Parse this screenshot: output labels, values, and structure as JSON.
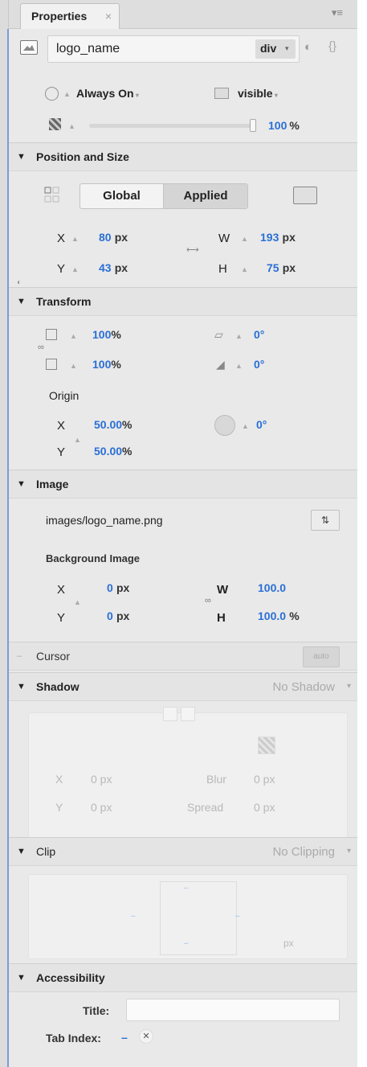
{
  "panel": {
    "tab_label": "Properties",
    "tab_close": "×",
    "menu_icon": "▾≡"
  },
  "element": {
    "name": "logo_name",
    "tag": "div",
    "tag_arrow": "▾"
  },
  "display": {
    "overflow": "Always On",
    "visibility": "visible",
    "opacity": "100",
    "opacity_unit": "%"
  },
  "position_size": {
    "title": "Position and Size",
    "mode_global": "Global",
    "mode_applied": "Applied",
    "x_label": "X",
    "x_value": "80",
    "x_unit": "px",
    "y_label": "Y",
    "y_value": "43",
    "y_unit": "px",
    "w_label": "W",
    "w_value": "193",
    "w_unit": "px",
    "h_label": "H",
    "h_value": "75",
    "h_unit": "px"
  },
  "transform": {
    "title": "Transform",
    "scale_x": "100",
    "scale_y": "100",
    "scale_unit": "%",
    "skew_x": "0°",
    "skew_y": "0°",
    "origin_label": "Origin",
    "origin_x_label": "X",
    "origin_x": "50.00",
    "origin_y_label": "Y",
    "origin_y": "50.00",
    "origin_unit": "%",
    "rotation": "0°"
  },
  "image": {
    "title": "Image",
    "path": "images/logo_name.png",
    "bg_label": "Background Image",
    "x_label": "X",
    "x_value": "0",
    "x_unit": "px",
    "y_label": "Y",
    "y_value": "0",
    "y_unit": "px",
    "w_label": "W",
    "w_value": "100.0",
    "h_label": "H",
    "h_value": "100.0",
    "size_unit": "%"
  },
  "cursor": {
    "title": "Cursor",
    "value": "auto"
  },
  "shadow": {
    "title": "Shadow",
    "value": "No Shadow",
    "x_label": "X",
    "x_value": "0 px",
    "y_label": "Y",
    "y_value": "0 px",
    "blur_label": "Blur",
    "blur_value": "0 px",
    "spread_label": "Spread",
    "spread_value": "0 px"
  },
  "clip": {
    "title": "Clip",
    "value": "No Clipping",
    "unit": "px"
  },
  "accessibility": {
    "title": "Accessibility",
    "title_label": "Title:",
    "title_value": "",
    "tabindex_label": "Tab Index:",
    "tabindex_value": "–"
  },
  "colors": {
    "accent_blue": "#2a6fd6",
    "panel_bg": "#e9e9e9",
    "section_bg": "#e4e4e4",
    "border_blue": "#7a9cd8"
  }
}
